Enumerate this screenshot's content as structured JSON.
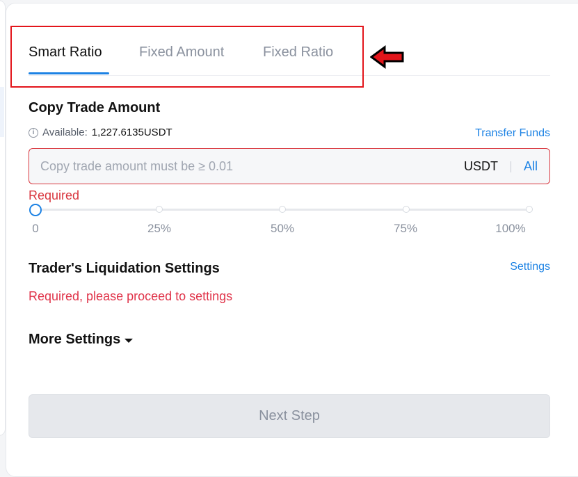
{
  "tabs": [
    {
      "label": "Smart Ratio",
      "active": true
    },
    {
      "label": "Fixed Amount",
      "active": false
    },
    {
      "label": "Fixed Ratio",
      "active": false
    }
  ],
  "copy_trade": {
    "title": "Copy Trade Amount",
    "available_label": "Available:",
    "available_value": "1,227.6135USDT",
    "transfer_link": "Transfer Funds",
    "input_placeholder": "Copy trade amount must be ≥ 0.01",
    "input_value": "",
    "unit": "USDT",
    "all_label": "All",
    "required_text": "Required"
  },
  "slider": {
    "value_percent": 0,
    "ticks": [
      "0",
      "25%",
      "50%",
      "75%",
      "100%"
    ]
  },
  "liquidation": {
    "title": "Trader's Liquidation Settings",
    "settings_link": "Settings",
    "error_text": "Required, please proceed to settings"
  },
  "more_settings": {
    "label": "More Settings"
  },
  "next_button": {
    "label": "Next Step"
  },
  "colors": {
    "accent": "#1c82e4",
    "error": "#d9363e",
    "annotation": "#e3151b"
  }
}
